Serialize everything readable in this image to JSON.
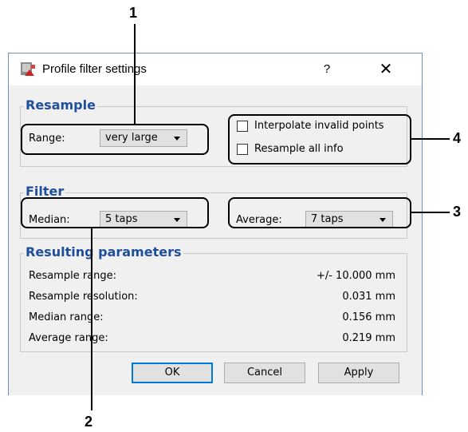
{
  "callouts": [
    "1",
    "2",
    "3",
    "4"
  ],
  "window": {
    "title": "Profile filter settings",
    "help_label": "?",
    "close_label": "✕"
  },
  "resample": {
    "title": "Resample",
    "range_label": "Range:",
    "range_value": "very large",
    "interpolate_label": "Interpolate invalid points",
    "resample_all_label": "Resample all info"
  },
  "filter": {
    "title": "Filter",
    "median_label": "Median:",
    "median_value": "5 taps",
    "average_label": "Average:",
    "average_value": "7 taps"
  },
  "results": {
    "title": "Resulting parameters",
    "rows": [
      {
        "label": "Resample range:",
        "value": "+/- 10.000 mm"
      },
      {
        "label": "Resample resolution:",
        "value": "0.031 mm"
      },
      {
        "label": "Median range:",
        "value": "0.156 mm"
      },
      {
        "label": "Average range:",
        "value": "0.219 mm"
      }
    ]
  },
  "buttons": {
    "ok": "OK",
    "cancel": "Cancel",
    "apply": "Apply"
  }
}
